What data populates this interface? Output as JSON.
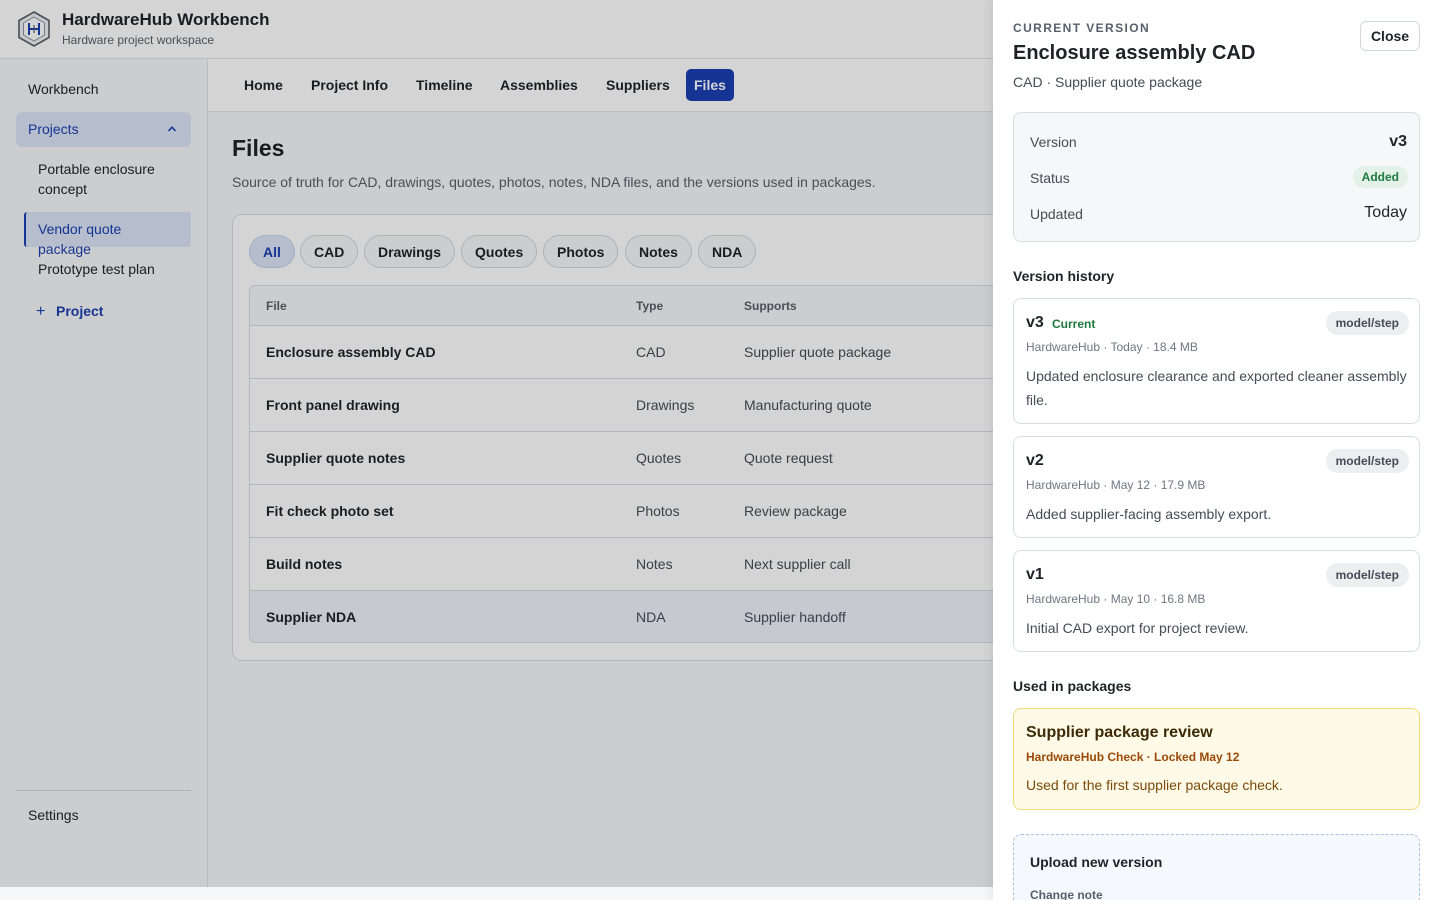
{
  "app": {
    "title": "HardwareHub Workbench",
    "subtitle": "Hardware project workspace",
    "logo_icon": "hexagon-chip-icon"
  },
  "sidebar": {
    "workbench": "Workbench",
    "projects_label": "Projects",
    "projects": [
      "Portable enclosure concept",
      "Vendor quote package",
      "Prototype test plan"
    ],
    "add_project": "Project",
    "settings": "Settings"
  },
  "tabs": [
    "Home",
    "Project Info",
    "Timeline",
    "Assemblies",
    "Suppliers",
    "Files"
  ],
  "active_tab": "Files",
  "main": {
    "title": "Files",
    "description": "Source of truth for CAD, drawings, quotes, photos, notes, NDA files, and the versions used in packages."
  },
  "filters": [
    "All",
    "CAD",
    "Drawings",
    "Quotes",
    "Photos",
    "Notes",
    "NDA"
  ],
  "active_filter": "All",
  "table": {
    "columns": [
      "File",
      "Type",
      "Supports"
    ],
    "rows": [
      {
        "file": "Enclosure assembly CAD",
        "type": "CAD",
        "supports": "Supplier quote package"
      },
      {
        "file": "Front panel drawing",
        "type": "Drawings",
        "supports": "Manufacturing quote"
      },
      {
        "file": "Supplier quote notes",
        "type": "Quotes",
        "supports": "Quote request"
      },
      {
        "file": "Fit check photo set",
        "type": "Photos",
        "supports": "Review package"
      },
      {
        "file": "Build notes",
        "type": "Notes",
        "supports": "Next supplier call"
      },
      {
        "file": "Supplier NDA",
        "type": "NDA",
        "supports": "Supplier handoff"
      }
    ]
  },
  "drawer": {
    "kicker": "CURRENT VERSION",
    "title": "Enclosure assembly CAD",
    "subtitle": "CAD · Supplier quote package",
    "close_label": "Close",
    "summary": {
      "version_label": "Version",
      "version": "v3",
      "status_label": "Status",
      "status": "Added",
      "updated_label": "Updated",
      "updated": "Today"
    },
    "history_heading": "Version history",
    "versions": [
      {
        "name": "v3",
        "current_label": "Current",
        "tag": "model/step",
        "meta": "HardwareHub · Today · 18.4 MB",
        "note": "Updated enclosure clearance and exported cleaner assembly file."
      },
      {
        "name": "v2",
        "tag": "model/step",
        "meta": "HardwareHub · May 12 · 17.9 MB",
        "note": "Added supplier-facing assembly export."
      },
      {
        "name": "v1",
        "tag": "model/step",
        "meta": "HardwareHub · May 10 · 16.8 MB",
        "note": "Initial CAD export for project review."
      }
    ],
    "packages_heading": "Used in packages",
    "package": {
      "title": "Supplier package review",
      "meta": "HardwareHub Check · Locked May 12",
      "note": "Used for the first supplier package check."
    },
    "upload": {
      "title": "Upload new version",
      "change_note_label": "Change note"
    }
  },
  "colors": {
    "accent": "#1a3fb3",
    "success": "#1f7a3f",
    "warning_bg": "#fffae8"
  }
}
